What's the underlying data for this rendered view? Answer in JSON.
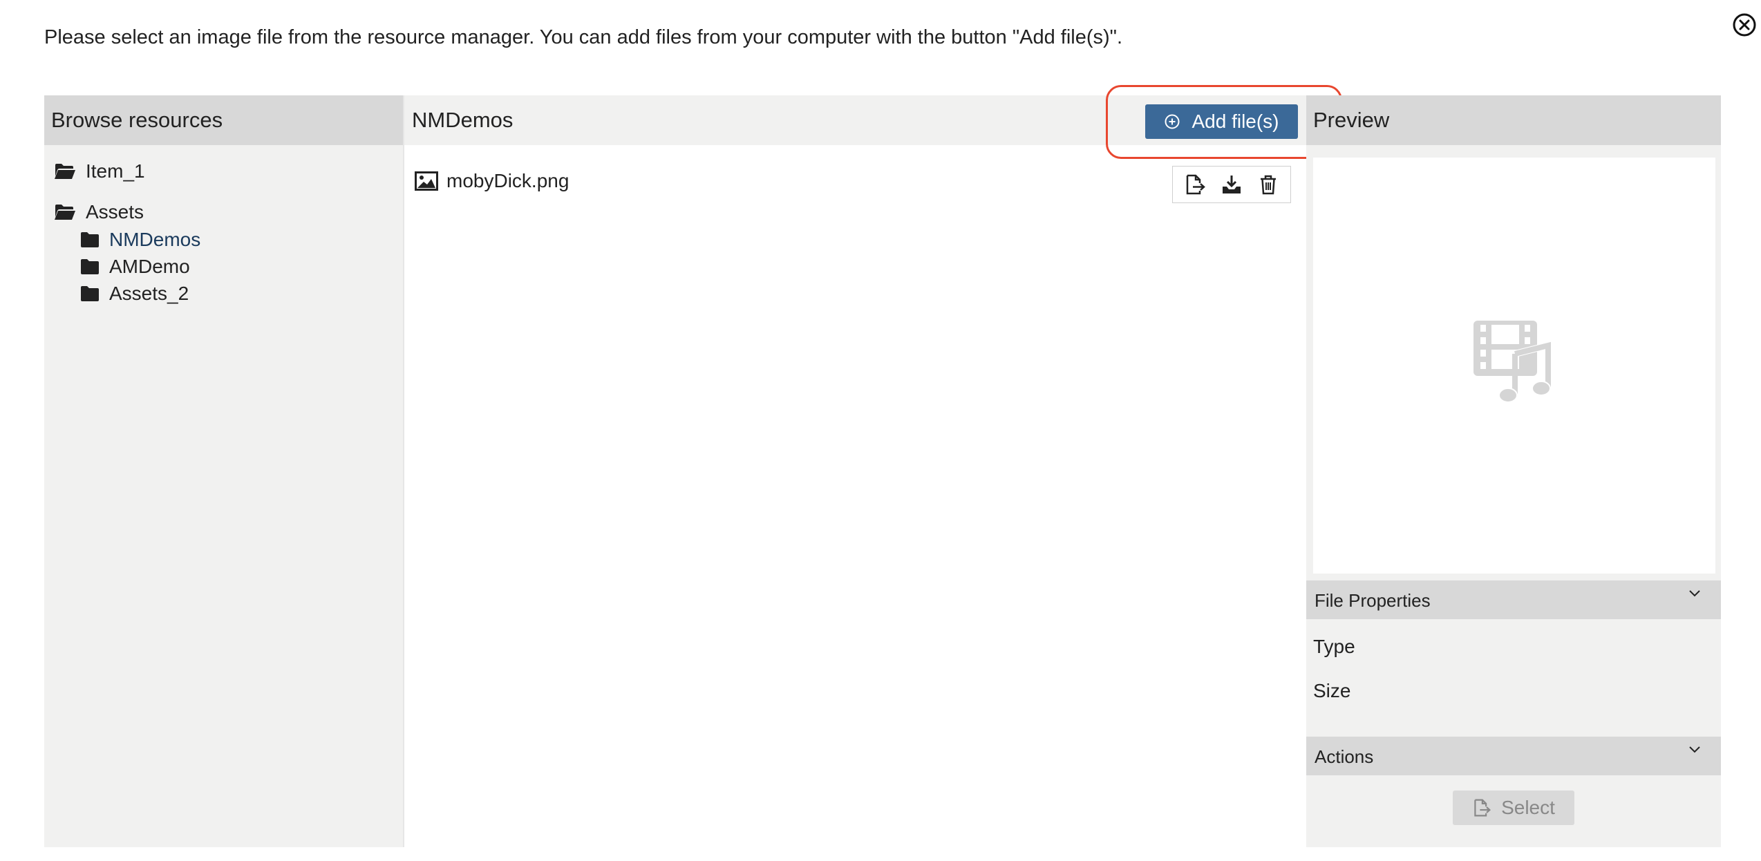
{
  "instruction": "Please select an image file from the resource manager. You can add files from your computer with the button \"Add file(s)\".",
  "left_panel": {
    "title": "Browse resources",
    "tree": [
      {
        "label": "Item_1",
        "icon": "folder-open-icon"
      },
      {
        "label": "Assets",
        "icon": "folder-open-icon",
        "children": [
          {
            "label": "NMDemos",
            "icon": "folder-icon",
            "active": true
          },
          {
            "label": "AMDemo",
            "icon": "folder-icon"
          },
          {
            "label": "Assets_2",
            "icon": "folder-icon"
          }
        ]
      }
    ]
  },
  "middle_panel": {
    "title": "NMDemos",
    "add_button_label": "Add file(s)",
    "files": [
      {
        "name": "mobyDick.png",
        "icon": "image-icon"
      }
    ],
    "file_actions": [
      "export-icon",
      "download-icon",
      "trash-icon"
    ]
  },
  "right_panel": {
    "title": "Preview",
    "preview_placeholder_icon": "media-placeholder-icon",
    "file_properties": {
      "title": "File Properties",
      "fields": [
        {
          "label": "Type",
          "value": ""
        },
        {
          "label": "Size",
          "value": ""
        }
      ]
    },
    "actions": {
      "title": "Actions",
      "select_label": "Select"
    }
  },
  "colors": {
    "accent": "#3b6998",
    "highlight": "#e8472f",
    "panel_bg": "#f1f1f0",
    "header_bg": "#d8d8d8"
  }
}
